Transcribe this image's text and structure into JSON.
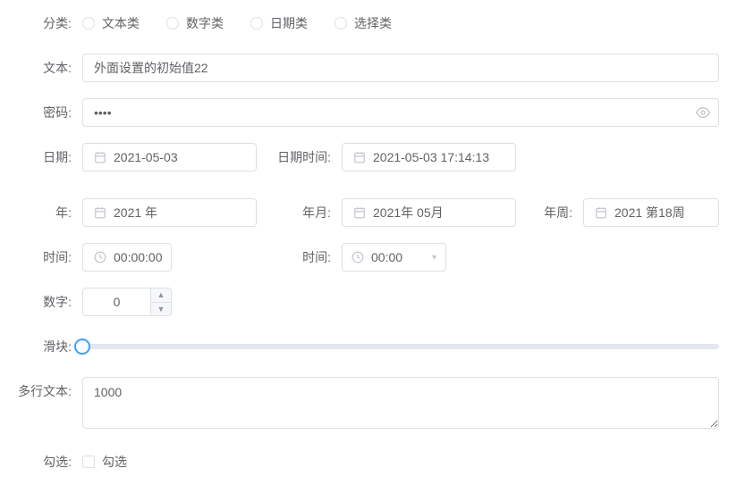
{
  "labels": {
    "category": "分类:",
    "text": "文本:",
    "password": "密码:",
    "date": "日期:",
    "datetime": "日期时间:",
    "year": "年:",
    "yearmonth": "年月:",
    "yearweek": "年周:",
    "time1": "时间:",
    "time2": "时间:",
    "number": "数字:",
    "slider": "滑块:",
    "multiline": "多行文本:",
    "checkbox": "勾选:"
  },
  "radios": {
    "r0": "文本类",
    "r1": "数字类",
    "r2": "日期类",
    "r3": "选择类"
  },
  "values": {
    "text": "外面设置的初始值22",
    "password": "••••",
    "date": "2021-05-03",
    "datetime": "2021-05-03 17:14:13",
    "year": "2021 年",
    "yearmonth": "2021年 05月",
    "yearweek": "2021 第18周",
    "time1": "00:00:00",
    "time2": "00:00",
    "number": "0",
    "slider": 0,
    "multiline": "1000",
    "checkbox_label": "勾选"
  }
}
